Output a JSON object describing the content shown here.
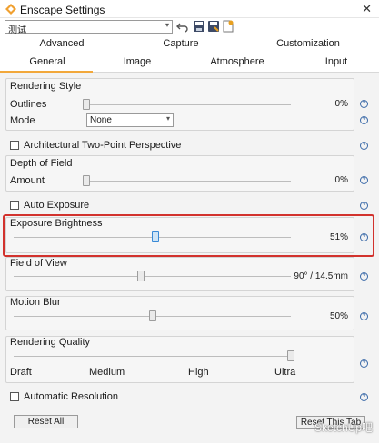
{
  "window": {
    "title": "Enscape Settings",
    "close_glyph": "✕"
  },
  "preset": {
    "value": "测试",
    "arrow": "▾"
  },
  "toolbar_icons": [
    "undo-icon",
    "save-icon",
    "save-as-icon",
    "new-preset-icon"
  ],
  "tabs_row1": [
    "Advanced",
    "Capture",
    "Customization"
  ],
  "tabs_row2": [
    "General",
    "Image",
    "Atmosphere",
    "Input"
  ],
  "active_tab": "General",
  "help_glyph": "?",
  "rendering_style": {
    "header": "Rendering Style",
    "outlines_label": "Outlines",
    "outlines_value": "0%",
    "outlines_level": 0,
    "mode_label": "Mode",
    "mode_value": "None",
    "mode_arrow": "▾"
  },
  "two_point": {
    "label": "Architectural Two-Point Perspective",
    "checked": false
  },
  "depth_of_field": {
    "header": "Depth of Field",
    "amount_label": "Amount",
    "amount_value": "0%",
    "level": 0
  },
  "auto_exposure": {
    "label": "Auto Exposure",
    "checked": false
  },
  "exposure_brightness": {
    "header": "Exposure Brightness",
    "value": "51%",
    "level": 0.51
  },
  "field_of_view": {
    "header": "Field of View",
    "value": "90° / 14.5mm",
    "level": 0.46
  },
  "motion_blur": {
    "header": "Motion Blur",
    "value": "50%",
    "level": 0.5
  },
  "rendering_quality": {
    "header": "Rendering Quality",
    "ticks": [
      "Draft",
      "Medium",
      "High",
      "Ultra"
    ],
    "level": 1.0
  },
  "automatic_resolution": {
    "label": "Automatic Resolution",
    "checked": false
  },
  "buttons": {
    "reset_all": "Reset All",
    "reset_tab": "Reset This Tab"
  },
  "watermark": "SketchUp吧",
  "colors": {
    "highlight": "#d2322d",
    "active_tab_underline": "#f2a83b",
    "active_thumb": "#3a8ad6"
  }
}
